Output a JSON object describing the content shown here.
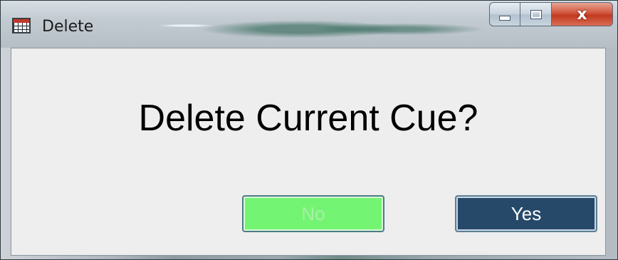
{
  "window": {
    "title": "Delete",
    "app_icon": "grid-table-icon",
    "controls": {
      "minimize_icon": "minimize-icon",
      "maximize_icon": "maximize-icon",
      "close_label": "x"
    }
  },
  "dialog": {
    "message": "Delete Current Cue?",
    "buttons": {
      "no_label": "No",
      "yes_label": "Yes"
    }
  },
  "colors": {
    "no_button": "#74f473",
    "yes_button": "#26496a",
    "client_background": "#eeeeee",
    "close_button": "#c23a22"
  }
}
